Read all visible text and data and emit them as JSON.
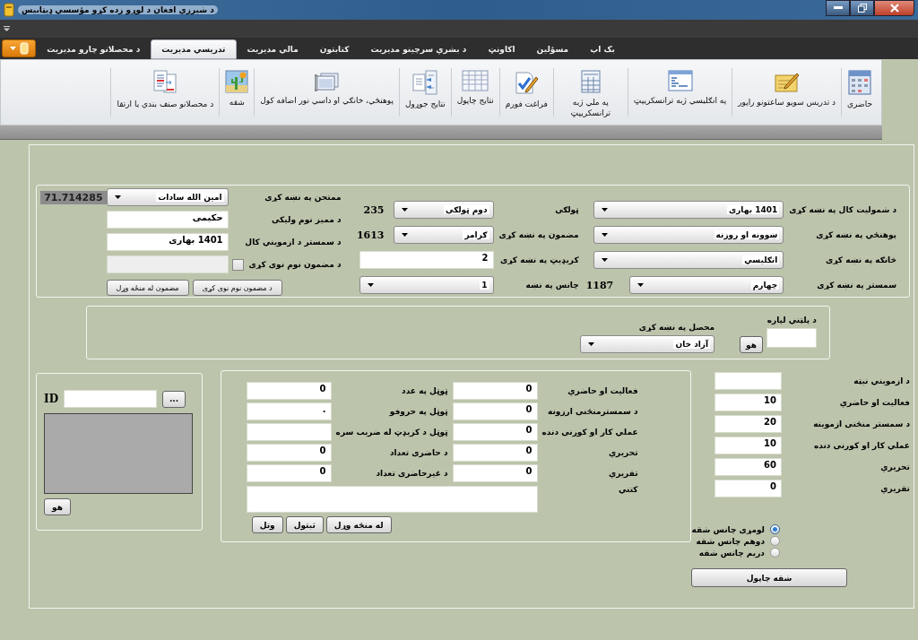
{
  "window": {
    "title": "د شيرزي افغان د لوړو زده کړو مؤسسي ډيټابيس"
  },
  "tabs": [
    {
      "label": "بک اپ",
      "selected": false
    },
    {
      "label": "مسؤلين",
      "selected": false
    },
    {
      "label": "اکاونټ",
      "selected": false
    },
    {
      "label": "د بشري سرچينو مديريت",
      "selected": false
    },
    {
      "label": "کتابتون",
      "selected": false
    },
    {
      "label": "مالي مديريت",
      "selected": false
    },
    {
      "label": "تدريسي مديريت",
      "selected": true
    },
    {
      "label": "د محصلانو چارو مديريت",
      "selected": false
    }
  ],
  "ribbon": [
    {
      "label": "حاضري",
      "kind": "calendar"
    },
    {
      "label": "د تدريس سويو ساعتونو راپور",
      "kind": "notepad"
    },
    {
      "label": "په انګليسي ژبه ترانسکريپټ",
      "kind": "window"
    },
    {
      "label": "په ملي ژبه ترانسکريپټ",
      "kind": "table"
    },
    {
      "label": "فراغت فورم",
      "kind": "checklist"
    },
    {
      "label": "نتايج چاپول",
      "kind": "grid"
    },
    {
      "label": "نتايج جوړول",
      "kind": "arrows"
    },
    {
      "label": "پوهنځي، خانګي او داسي نور اضافه کول",
      "kind": "windows"
    },
    {
      "label": "شقه",
      "kind": "landscape"
    },
    {
      "label": "د محصلانو صنف بندي يا ارتقا",
      "kind": "documents"
    }
  ],
  "filters": {
    "right": [
      {
        "label": "د شموليت کال په نښه کړی",
        "kind": "combo",
        "value": "1401 بهاری"
      },
      {
        "label": "پوهنځي په نښه کړی",
        "kind": "combo",
        "value": "ښوونه او روزنه"
      },
      {
        "label": "څانګه په نښه کړی",
        "kind": "combo",
        "value": "انګليسي"
      },
      {
        "label": "سمستر په نښه کړی",
        "kind": "combo",
        "value": "چهارم",
        "count": "1187"
      }
    ],
    "middle": [
      {
        "label": "ټولګی",
        "kind": "combo",
        "value": "دوم ټولګی",
        "count": "235"
      },
      {
        "label": "مضمون په نښه کړی",
        "kind": "combo",
        "value": "ګرامر",
        "count": "1613"
      },
      {
        "label": "کريډيټ په نښه کړی",
        "kind": "field",
        "value": "2"
      },
      {
        "label": "چانس په نښه",
        "kind": "combo",
        "value": "1"
      }
    ],
    "left": [
      {
        "label": "ممتحن په نښه کړی",
        "kind": "combo",
        "value": "امين الله سادات"
      },
      {
        "label": "د مميز نوم وليکی",
        "kind": "field",
        "value": "حکيمی"
      },
      {
        "label": "د سمستر د ازمويني کال",
        "kind": "field",
        "value": "1401 بهاری"
      },
      {
        "label": "د مضمون نوم نوی کړی",
        "kind": "checkbox",
        "checked": false,
        "disabled": true
      }
    ],
    "buttons": [
      "د مضمون نوم نوی کړی",
      "مضمون له منځه وړل"
    ],
    "score": "71.714285"
  },
  "search": {
    "label": "د پلټني لپاره",
    "button": "هو",
    "student_label": "محصل په نښه کړی",
    "student": "آزاد خان"
  },
  "photo": {
    "id_label": "ID",
    "browse": "...",
    "button": "هو"
  },
  "marks": {
    "obtained": [
      {
        "label": "فعاليت او حاضري",
        "value": "0"
      },
      {
        "label": "د سمسترمنځنی ارزونه",
        "value": "0"
      },
      {
        "label": "عملي کار او کورنی دنده",
        "value": "0"
      },
      {
        "label": "تحريري",
        "value": "0"
      },
      {
        "label": "تقريري",
        "value": "0"
      }
    ],
    "totals": [
      {
        "label": "ټوټل په عدد",
        "value": "0"
      },
      {
        "label": "ټوټل په حروفو",
        "value": "."
      },
      {
        "label": "ټوټل د کريډټ له ضريب سره"
      },
      {
        "label": "د حاضری تعداد",
        "value": "0"
      },
      {
        "label": "د غيرحاضری تعداد",
        "value": "0"
      }
    ],
    "remarks_label": "کتني",
    "buttons": [
      "له منځه وړل",
      "ثبتول",
      "وتل"
    ]
  },
  "weights": {
    "items": [
      {
        "label": "د ازمويني نيټه"
      },
      {
        "label": "فعاليت او حاضري",
        "value": "10"
      },
      {
        "label": "د سمستر منځنی ازموينه",
        "value": "20"
      },
      {
        "label": "عملي کار او کورنی دنده",
        "value": "10"
      },
      {
        "label": "تحريري",
        "value": "60"
      },
      {
        "label": "تقريري",
        "value": "0"
      }
    ],
    "chances": [
      {
        "label": "لومړی چانس شقه",
        "selected": true
      },
      {
        "label": "دوهم چانس شقه",
        "selected": false
      },
      {
        "label": "دريم چانس شقه",
        "selected": false
      }
    ],
    "print_button": "شقه چاپول"
  }
}
